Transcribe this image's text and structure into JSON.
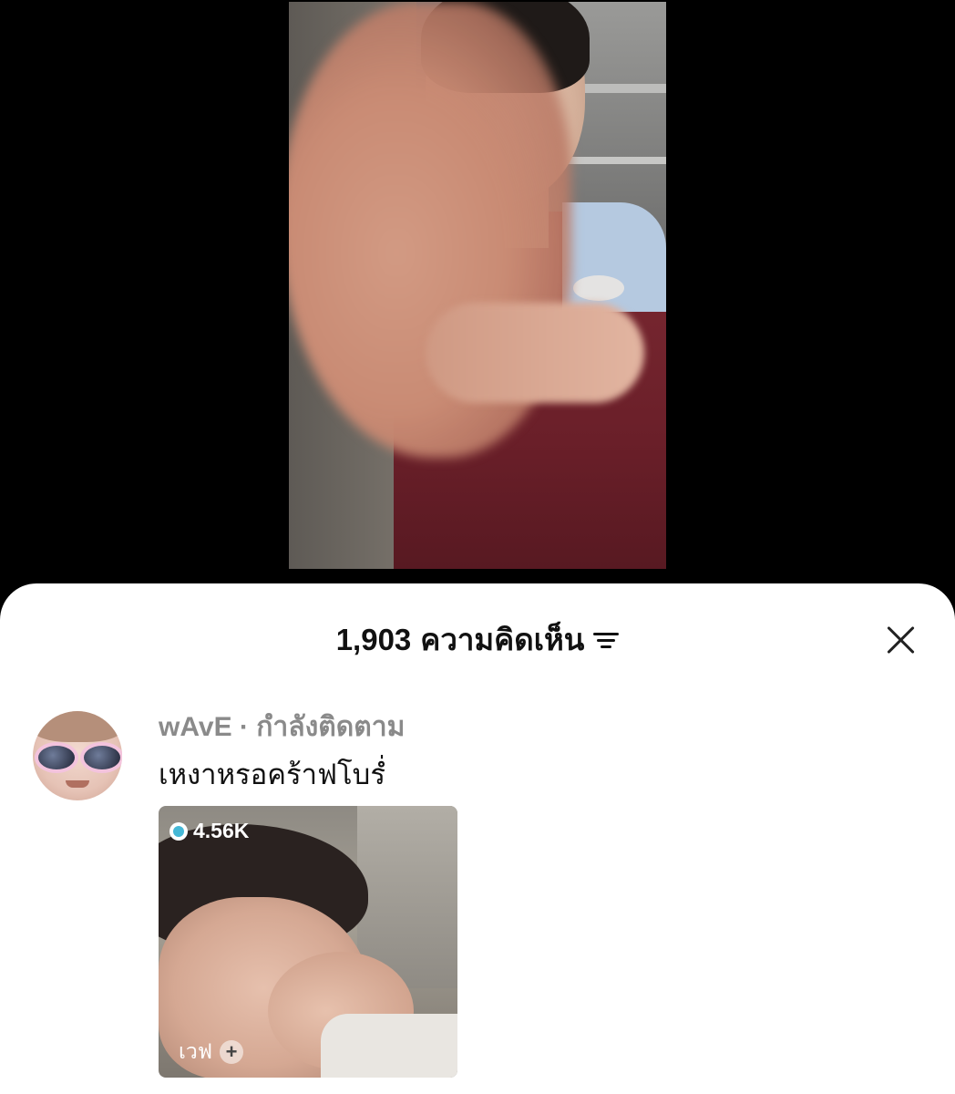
{
  "header": {
    "comment_count": "1,903",
    "comment_label": "ความคิดเห็น"
  },
  "icons": {
    "sort": "sort-icon",
    "close": "close-icon"
  },
  "comment": {
    "username": "wAvE",
    "separator": " · ",
    "follow_status": "กำลังติดตาม",
    "text": "เหงาหรอคร้าฟโบรํ่",
    "media": {
      "views": "4.56K",
      "label": "เวฟ",
      "add_symbol": "+"
    }
  }
}
